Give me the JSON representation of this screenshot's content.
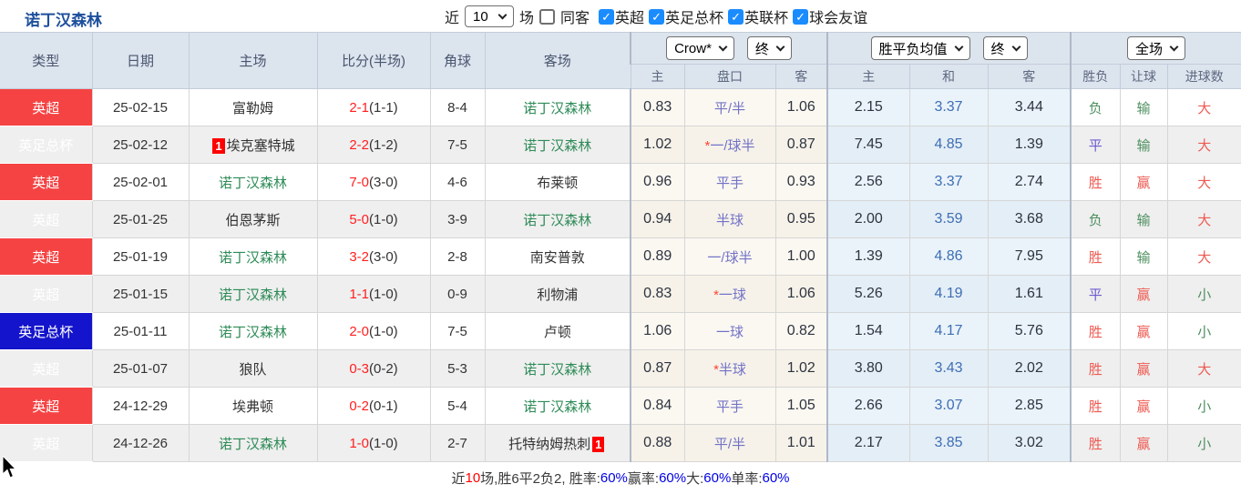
{
  "page": {
    "title": "诺丁汉森林"
  },
  "palette": {
    "title_blue": "#1d4f9c",
    "check_blue": "#1a8cff",
    "head_bg": "#dce4ee",
    "stripe": "#efefef",
    "red_type": "#f54343",
    "blue_type": "#1414cc",
    "target_green": "#2e8b57",
    "score_red": "#ff1f1f",
    "crow_bg": "#fbf8f1",
    "avg_bg": "#eaf3fa",
    "pk_blue": "#7272c8",
    "draw_blue": "#3d6eb4",
    "res_red": "#ee5a52",
    "res_green": "#4d8f5f",
    "res_vio": "#6a5acd",
    "pct_blue": "#0000e6"
  },
  "toolbar": {
    "recent_label": "近",
    "match_count": "10",
    "matches_label": "场",
    "same_opponent_label": "同客",
    "same_opponent_checked": false,
    "league_filters": [
      {
        "label": "英超",
        "checked": true
      },
      {
        "label": "英足总杯",
        "checked": true
      },
      {
        "label": "英联杯",
        "checked": true
      },
      {
        "label": "球会友谊",
        "checked": true
      }
    ]
  },
  "table": {
    "headers": {
      "main": [
        "类型",
        "日期",
        "主场",
        "比分(半场)",
        "角球",
        "客场"
      ],
      "sub": [
        "主",
        "盘口",
        "客",
        "主",
        "和",
        "客",
        "胜负",
        "让球",
        "进球数"
      ]
    },
    "selects": {
      "odds_source": "Crow*",
      "odds_time": "终",
      "avg_type": "胜平负均值",
      "avg_time": "终",
      "scope": "全场"
    },
    "rows": [
      {
        "type": "英超",
        "date": "25-02-15",
        "home": "富勒姆",
        "home_badge": "",
        "score": "2-1",
        "half": "(1-1)",
        "corner": "8-4",
        "away": "诺丁汉森林",
        "away_badge": "",
        "crow_home": "0.83",
        "pk_star": false,
        "pk": "平/半",
        "crow_away": "1.06",
        "avg_home": "2.15",
        "avg_draw": "3.37",
        "avg_away": "3.44",
        "result": "负",
        "handicap_result": "输",
        "goals": "大"
      },
      {
        "type": "英足总杯",
        "date": "25-02-12",
        "home": "埃克塞特城",
        "home_badge": "1",
        "score": "2-2",
        "half": "(1-2)",
        "corner": "7-5",
        "away": "诺丁汉森林",
        "away_badge": "",
        "crow_home": "1.02",
        "pk_star": true,
        "pk": "一/球半",
        "crow_away": "0.87",
        "avg_home": "7.45",
        "avg_draw": "4.85",
        "avg_away": "1.39",
        "result": "平",
        "handicap_result": "输",
        "goals": "大"
      },
      {
        "type": "英超",
        "date": "25-02-01",
        "home": "诺丁汉森林",
        "home_badge": "",
        "score": "7-0",
        "half": "(3-0)",
        "corner": "4-6",
        "away": "布莱顿",
        "away_badge": "",
        "crow_home": "0.96",
        "pk_star": false,
        "pk": "平手",
        "crow_away": "0.93",
        "avg_home": "2.56",
        "avg_draw": "3.37",
        "avg_away": "2.74",
        "result": "胜",
        "handicap_result": "赢",
        "goals": "大"
      },
      {
        "type": "英超",
        "date": "25-01-25",
        "home": "伯恩茅斯",
        "home_badge": "",
        "score": "5-0",
        "half": "(1-0)",
        "corner": "3-9",
        "away": "诺丁汉森林",
        "away_badge": "",
        "crow_home": "0.94",
        "pk_star": false,
        "pk": "半球",
        "crow_away": "0.95",
        "avg_home": "2.00",
        "avg_draw": "3.59",
        "avg_away": "3.68",
        "result": "负",
        "handicap_result": "输",
        "goals": "大"
      },
      {
        "type": "英超",
        "date": "25-01-19",
        "home": "诺丁汉森林",
        "home_badge": "",
        "score": "3-2",
        "half": "(3-0)",
        "corner": "2-8",
        "away": "南安普敦",
        "away_badge": "",
        "crow_home": "0.89",
        "pk_star": false,
        "pk": "一/球半",
        "crow_away": "1.00",
        "avg_home": "1.39",
        "avg_draw": "4.86",
        "avg_away": "7.95",
        "result": "胜",
        "handicap_result": "输",
        "goals": "大"
      },
      {
        "type": "英超",
        "date": "25-01-15",
        "home": "诺丁汉森林",
        "home_badge": "",
        "score": "1-1",
        "half": "(1-0)",
        "corner": "0-9",
        "away": "利物浦",
        "away_badge": "",
        "crow_home": "0.83",
        "pk_star": true,
        "pk": "一球",
        "crow_away": "1.06",
        "avg_home": "5.26",
        "avg_draw": "4.19",
        "avg_away": "1.61",
        "result": "平",
        "handicap_result": "赢",
        "goals": "小"
      },
      {
        "type": "英足总杯",
        "date": "25-01-11",
        "home": "诺丁汉森林",
        "home_badge": "",
        "score": "2-0",
        "half": "(1-0)",
        "corner": "7-5",
        "away": "卢顿",
        "away_badge": "",
        "crow_home": "1.06",
        "pk_star": false,
        "pk": "一球",
        "crow_away": "0.82",
        "avg_home": "1.54",
        "avg_draw": "4.17",
        "avg_away": "5.76",
        "result": "胜",
        "handicap_result": "赢",
        "goals": "小"
      },
      {
        "type": "英超",
        "date": "25-01-07",
        "home": "狼队",
        "home_badge": "",
        "score": "0-3",
        "half": "(0-2)",
        "corner": "5-3",
        "away": "诺丁汉森林",
        "away_badge": "",
        "crow_home": "0.87",
        "pk_star": true,
        "pk": "半球",
        "crow_away": "1.02",
        "avg_home": "3.80",
        "avg_draw": "3.43",
        "avg_away": "2.02",
        "result": "胜",
        "handicap_result": "赢",
        "goals": "大"
      },
      {
        "type": "英超",
        "date": "24-12-29",
        "home": "埃弗顿",
        "home_badge": "",
        "score": "0-2",
        "half": "(0-1)",
        "corner": "5-4",
        "away": "诺丁汉森林",
        "away_badge": "",
        "crow_home": "0.84",
        "pk_star": false,
        "pk": "平手",
        "crow_away": "1.05",
        "avg_home": "2.66",
        "avg_draw": "3.07",
        "avg_away": "2.85",
        "result": "胜",
        "handicap_result": "赢",
        "goals": "小"
      },
      {
        "type": "英超",
        "date": "24-12-26",
        "home": "诺丁汉森林",
        "home_badge": "",
        "score": "1-0",
        "half": "(1-0)",
        "corner": "2-7",
        "away": "托特纳姆热刺",
        "away_badge": "1",
        "crow_home": "0.88",
        "pk_star": false,
        "pk": "平/半",
        "crow_away": "1.01",
        "avg_home": "2.17",
        "avg_draw": "3.85",
        "avg_away": "3.02",
        "result": "胜",
        "handicap_result": "赢",
        "goals": "小"
      }
    ]
  },
  "footer": {
    "parts": [
      {
        "text": "近",
        "color": "default"
      },
      {
        "text": "10",
        "color": "red"
      },
      {
        "text": "场,胜6平2负2, 胜率:",
        "color": "default"
      },
      {
        "text": "60%",
        "color": "blue"
      },
      {
        "text": " 赢率:",
        "color": "default"
      },
      {
        "text": "60%",
        "color": "blue"
      },
      {
        "text": " 大:",
        "color": "default"
      },
      {
        "text": "60%",
        "color": "blue"
      },
      {
        "text": " 单率:",
        "color": "default"
      },
      {
        "text": "60%",
        "color": "blue"
      }
    ]
  }
}
